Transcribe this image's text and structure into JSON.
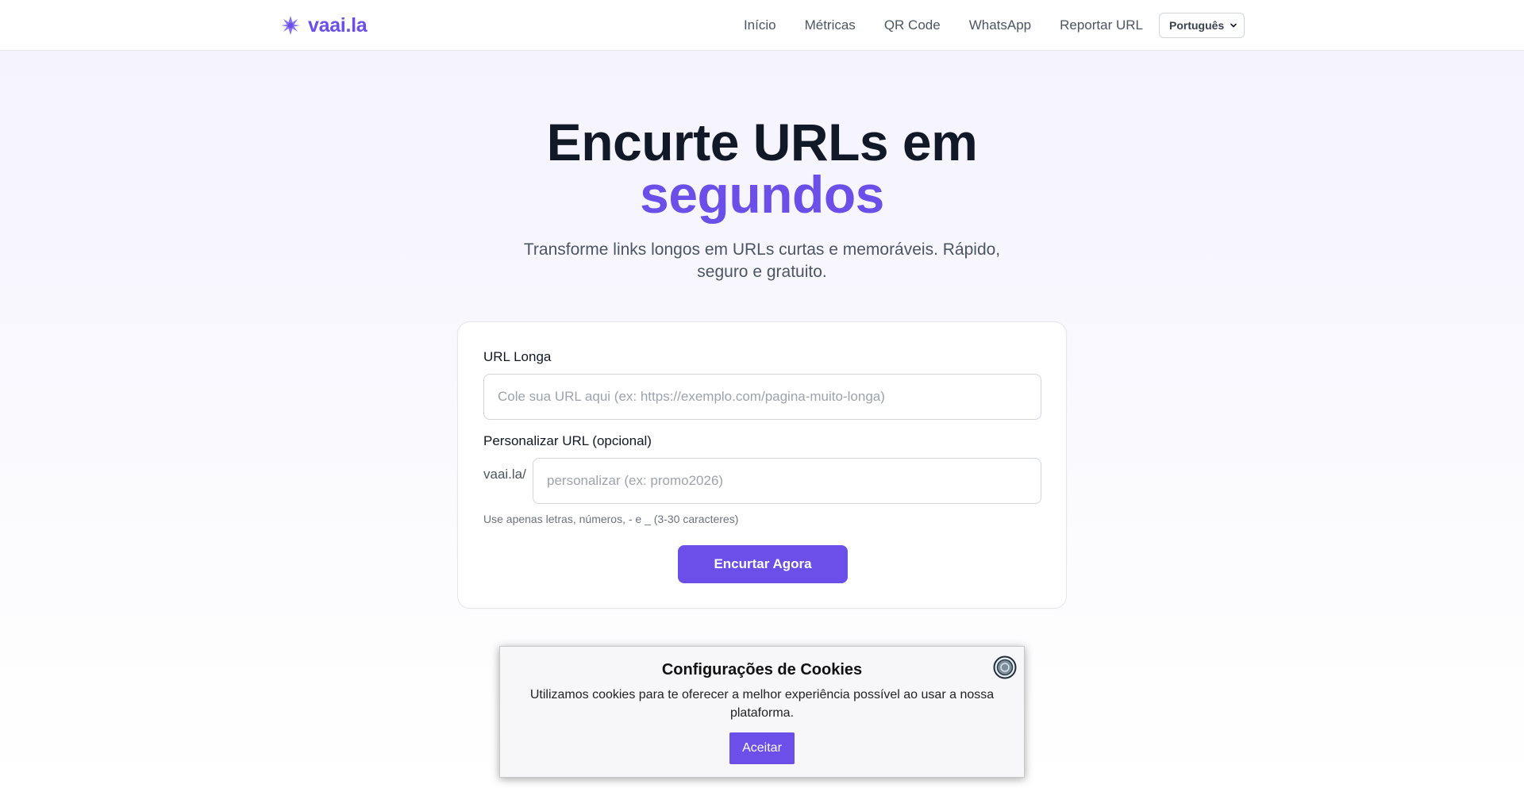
{
  "brand": {
    "name": "vaai.la",
    "icon": "sparkle-logo-icon",
    "color": "#6b4fe8"
  },
  "nav": {
    "links": [
      "Início",
      "Métricas",
      "QR Code",
      "WhatsApp",
      "Reportar URL"
    ],
    "language": "Português"
  },
  "hero": {
    "title_line1": "Encurte URLs em",
    "title_accent": "segundos",
    "subtitle": "Transforme links longos em URLs curtas e memoráveis. Rápido, seguro e gratuito."
  },
  "form": {
    "url_label": "URL Longa",
    "url_value": "",
    "url_placeholder": "Cole sua URL aqui (ex: https://exemplo.com/pagina-muito-longa)",
    "custom_label": "Personalizar URL (opcional)",
    "custom_prefix": "vaai.la/",
    "custom_value": "",
    "custom_placeholder": "personalizar (ex: promo2026)",
    "hint": "Use apenas letras, números, - e _ (3-30 caracteres)",
    "submit_label": "Encurtar Agora"
  },
  "cookie": {
    "title": "Configurações de Cookies",
    "text": "Utilizamos cookies para te oferecer a melhor experiência possível ao usar a nossa plataforma.",
    "accept_label": "Aceitar",
    "close_icon": "close-circle-icon"
  },
  "colors": {
    "accent": "#6b4fe8",
    "text_dark": "#111827",
    "text_muted": "#4b5563"
  }
}
